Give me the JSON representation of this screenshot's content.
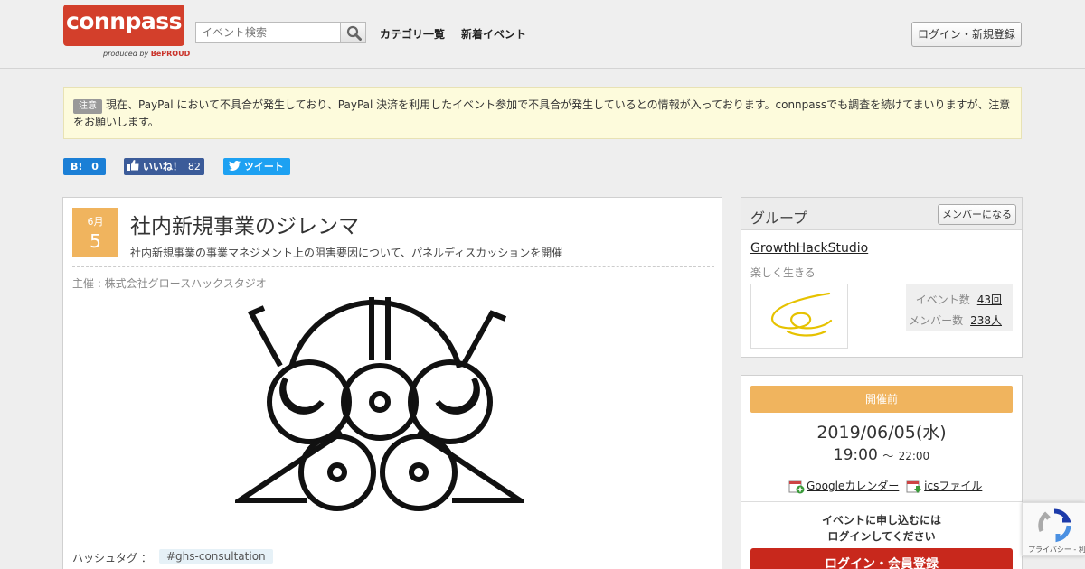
{
  "header": {
    "logo_text": "connpass",
    "logo_sub_prefix": "produced by",
    "logo_sub_brand": "BePROUD",
    "search_placeholder": "イベント検索",
    "nav": [
      "カテゴリ一覧",
      "新着イベント"
    ],
    "login_label": "ログイン・新規登録"
  },
  "notice": {
    "tag": "注意",
    "text": "現在、PayPal において不具合が発生しており、PayPal 決済を利用したイベント参加で不具合が発生しているとの情報が入っております。connpassでも調査を続けてまいりますが、注意をお願いします。"
  },
  "social": {
    "hatena_label": "B!",
    "hatena_count": "0",
    "facebook_label": "いいね！",
    "facebook_count": "82",
    "twitter_label": "ツイート"
  },
  "event": {
    "month": "6月",
    "day": "5",
    "title": "社内新規事業のジレンマ",
    "subtitle": "社内新規事業の事業マネジメント上の阻害要因について、パネルディスカッションを開催",
    "organizer": "主催 : 株式会社グロースハックスタジオ",
    "hashtag_label": "ハッシュタグ ：",
    "hashtag": "#ghs-consultation"
  },
  "group": {
    "heading": "グループ",
    "join_label": "メンバーになる",
    "name": "GrowthHackStudio",
    "tagline": "楽しく生きる",
    "events_label": "イベント数",
    "events_count": "43回",
    "members_label": "メンバー数",
    "members_count": "238人"
  },
  "schedule": {
    "status": "開催前",
    "date": "2019/06/05(水)",
    "start": "19:00",
    "separator": "～",
    "end": "22:00",
    "google_cal": "Googleカレンダー",
    "ics": "icsファイル",
    "apply_line1": "イベントに申し込むには",
    "apply_line2": "ログインしてください",
    "apply_button": "ログイン・会員登録"
  },
  "recaptcha": {
    "links": "プライバシー - 利用規約"
  }
}
